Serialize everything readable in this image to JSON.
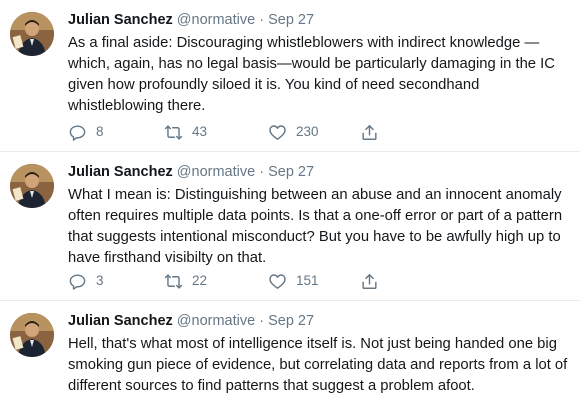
{
  "tweets": [
    {
      "author_name": "Julian Sanchez",
      "author_handle": "@normative",
      "separator": "·",
      "date": "Sep 27",
      "text": "As a final aside: Discouraging whistleblowers with indirect knowledge —which, again, has no legal basis—would be particularly damaging in the IC given how profoundly siloed it is. You kind of need secondhand whistleblowing there.",
      "replies": "8",
      "retweets": "43",
      "likes": "230"
    },
    {
      "author_name": "Julian Sanchez",
      "author_handle": "@normative",
      "separator": "·",
      "date": "Sep 27",
      "text": "What I mean is: Distinguishing between an abuse and an innocent anomaly often requires multiple data points. Is that a one-off error or part of a pattern that suggests intentional misconduct? But you have to be awfully high up to have firsthand visibilty on that.",
      "replies": "3",
      "retweets": "22",
      "likes": "151"
    },
    {
      "author_name": "Julian Sanchez",
      "author_handle": "@normative",
      "separator": "·",
      "date": "Sep 27",
      "text": "Hell, that's what most of intelligence itself is. Not just being  handed one big smoking gun piece of evidence, but correlating data and reports from a lot of different sources to find patterns that suggest a problem afoot."
    }
  ],
  "icons": {
    "reply": "reply-icon",
    "retweet": "retweet-icon",
    "like": "heart-icon",
    "share": "share-icon"
  },
  "colors": {
    "muted": "#657786",
    "text": "#14171a",
    "divider": "#e6ecf0"
  }
}
